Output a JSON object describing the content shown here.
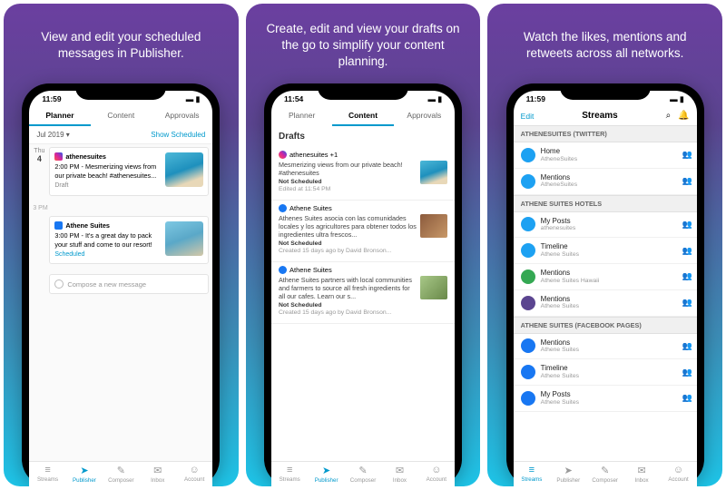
{
  "panels": [
    {
      "caption": "View and edit your scheduled messages in Publisher.",
      "time": "11:59",
      "tabs": [
        "Planner",
        "Content",
        "Approvals"
      ],
      "active_tab": 0,
      "subbar_left": "Jul 2019",
      "subbar_right": "Show Scheduled",
      "day_label": "Thu",
      "day_num": "4",
      "cards": [
        {
          "icon": "ig",
          "user": "athenesuites",
          "text": "2:00 PM - Mesmerizing views from our private beach! #athenesuites...",
          "status": "Draft",
          "status_cls": "draft",
          "thumb": "thumb"
        },
        {
          "icon": "fb",
          "user": "Athene Suites",
          "text": "3:00 PM - It's a great day to pack your stuff and come to our resort!",
          "status": "Scheduled",
          "status_cls": "sch",
          "thumb": "thumb2"
        }
      ],
      "timeslot": "3 PM",
      "compose_placeholder": "Compose a new message"
    },
    {
      "caption": "Create, edit and view your drafts on the go to simplify your content planning.",
      "time": "11:54",
      "tabs": [
        "Planner",
        "Content",
        "Approvals"
      ],
      "active_tab": 1,
      "header": "Drafts",
      "drafts": [
        {
          "icon": "ig",
          "user": "athenesuites +1",
          "text": "Mesmerizing views from our private beach! #athenesuites",
          "meta_title": "Not Scheduled",
          "meta_sub": "Edited at 11:54 PM",
          "thumb": "thumb"
        },
        {
          "icon": "fb",
          "user": "Athene Suites",
          "text": "Athenes Suites asocia con las comunidades locales y los agricultores para obtener todos los ingredientes ultra frescos...",
          "meta_title": "Not Scheduled",
          "meta_sub": "Created 15 days ago by David Bronson...",
          "thumb": "thumb3"
        },
        {
          "icon": "fb",
          "user": "Athene Suites",
          "text": "Athene Suites partners with local communities and farmers to source all fresh ingredients for all our cafes. Learn our s...",
          "meta_title": "Not Scheduled",
          "meta_sub": "Created 15 days ago by David Bronson...",
          "thumb": "thumb4"
        }
      ]
    },
    {
      "caption": "Watch the likes, mentions and retweets across all networks.",
      "time": "11:59",
      "edit": "Edit",
      "title": "Streams",
      "sections": [
        {
          "name": "ATHENESUITES (TWITTER)",
          "items": [
            {
              "icon": "tw",
              "title": "Home",
              "sub": "AtheneSuites"
            },
            {
              "icon": "tw",
              "title": "Mentions",
              "sub": "AtheneSuites"
            }
          ]
        },
        {
          "name": "ATHENE SUITES HOTELS",
          "items": [
            {
              "icon": "tw",
              "title": "My Posts",
              "sub": "athenesuites"
            },
            {
              "icon": "tw",
              "title": "Timeline",
              "sub": "Athene Suites"
            },
            {
              "icon": "g",
              "title": "Mentions",
              "sub": "Athene Suites Hawaii"
            },
            {
              "icon": "a",
              "title": "Mentions",
              "sub": "Athene Suites"
            }
          ]
        },
        {
          "name": "ATHENE SUITES (FACEBOOK PAGES)",
          "items": [
            {
              "icon": "fb",
              "title": "Mentions",
              "sub": "Athene Suites"
            },
            {
              "icon": "fb",
              "title": "Timeline",
              "sub": "Athene Suites"
            },
            {
              "icon": "fb",
              "title": "My Posts",
              "sub": "Athene Suites"
            }
          ]
        }
      ]
    }
  ],
  "nav_items": [
    "Streams",
    "Publisher",
    "Composer",
    "Inbox",
    "Account"
  ],
  "nav_icons": [
    "≡",
    "➤",
    "✎",
    "✉",
    "☺"
  ],
  "nav_actives": {
    "0": 1,
    "1": 1,
    "2": 0
  }
}
